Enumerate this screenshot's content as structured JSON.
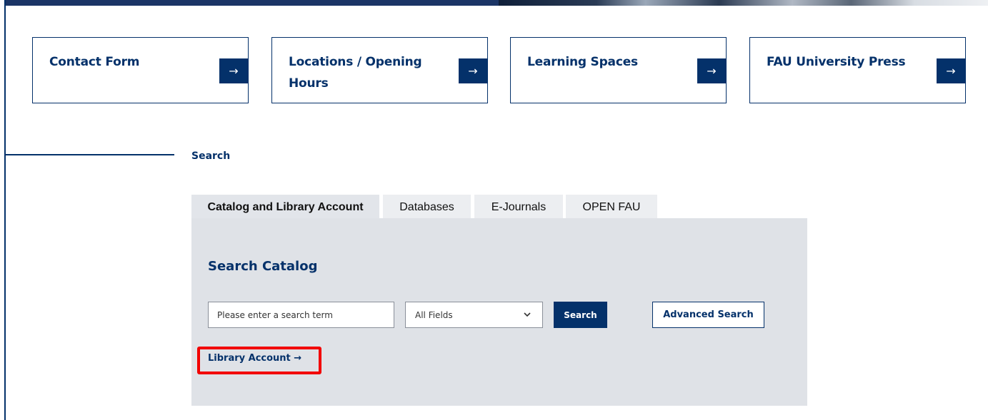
{
  "quick_links": [
    {
      "label_line1": "Contact Form",
      "label_line2": "",
      "arrow": "→"
    },
    {
      "label_line1": "Locations / Opening",
      "label_line2": "Hours",
      "arrow": "→"
    },
    {
      "label_line1": "Learning Spaces",
      "label_line2": "",
      "arrow": "→"
    },
    {
      "label_line1": "FAU University Press",
      "label_line2": "",
      "arrow": "→"
    }
  ],
  "section": {
    "title": "Search"
  },
  "tabs": [
    {
      "label": "Catalog and Library Account",
      "active": true
    },
    {
      "label": "Databases",
      "active": false
    },
    {
      "label": "E-Journals",
      "active": false
    },
    {
      "label": "OPEN FAU",
      "active": false
    }
  ],
  "catalog": {
    "title": "Search Catalog",
    "search_placeholder": "Please enter a search term",
    "field_selected": "All Fields",
    "search_label": "Search",
    "advanced_label": "Advanced Search",
    "library_account_label": "Library Account →"
  },
  "icons": {
    "dropdown": "chevron-down-icon",
    "card_arrow": "arrow-right-icon"
  },
  "colors": {
    "brand": "#04316a",
    "panel_bg": "#dfe2e7",
    "highlight": "#f20000"
  }
}
